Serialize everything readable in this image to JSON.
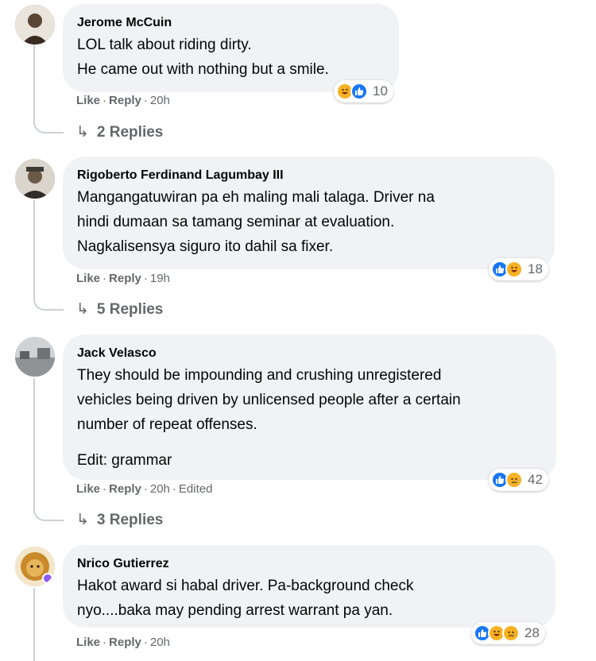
{
  "comments": [
    {
      "author": "Jerome McCuin",
      "lines": [
        "LOL talk about riding dirty.",
        "He came out with nothing but a smile."
      ],
      "like": "Like",
      "reply": "Reply",
      "time": "20h",
      "edited": "",
      "reactions": [
        "haha-icon",
        "like-icon"
      ],
      "reaction_count": "10",
      "replies": "2 Replies"
    },
    {
      "author": "Rigoberto Ferdinand Lagumbay III",
      "lines": [
        "Mangangatuwiran pa eh maling mali talaga. Driver na",
        "hindi dumaan sa tamang seminar at evaluation.",
        "Nagkalisensya siguro ito dahil sa fixer."
      ],
      "like": "Like",
      "reply": "Reply",
      "time": "19h",
      "edited": "",
      "reactions": [
        "like-icon",
        "haha-icon"
      ],
      "reaction_count": "18",
      "replies": "5 Replies"
    },
    {
      "author": "Jack Velasco",
      "lines": [
        "They should be impounding and crushing unregistered",
        "vehicles being driven by unlicensed people after a certain",
        "number of repeat offenses."
      ],
      "extra": "Edit: grammar",
      "like": "Like",
      "reply": "Reply",
      "time": "20h",
      "edited": "Edited",
      "reactions": [
        "like-icon",
        "sad-icon"
      ],
      "reaction_count": "42",
      "replies": "3 Replies"
    },
    {
      "author": "Nrico Gutierrez",
      "lines": [
        "Hakot award si habal driver. Pa-background check",
        "nyo....baka may pending arrest warrant pa yan."
      ],
      "like": "Like",
      "reply": "Reply",
      "time": "20h",
      "edited": "",
      "reactions": [
        "like-icon",
        "haha-icon",
        "sad-icon"
      ],
      "reaction_count": "28",
      "replies": ""
    }
  ],
  "colors": {
    "bubble": "#f0f2f5",
    "meta": "#65676b",
    "like": "#1877f2",
    "haha": "#f7b125"
  }
}
